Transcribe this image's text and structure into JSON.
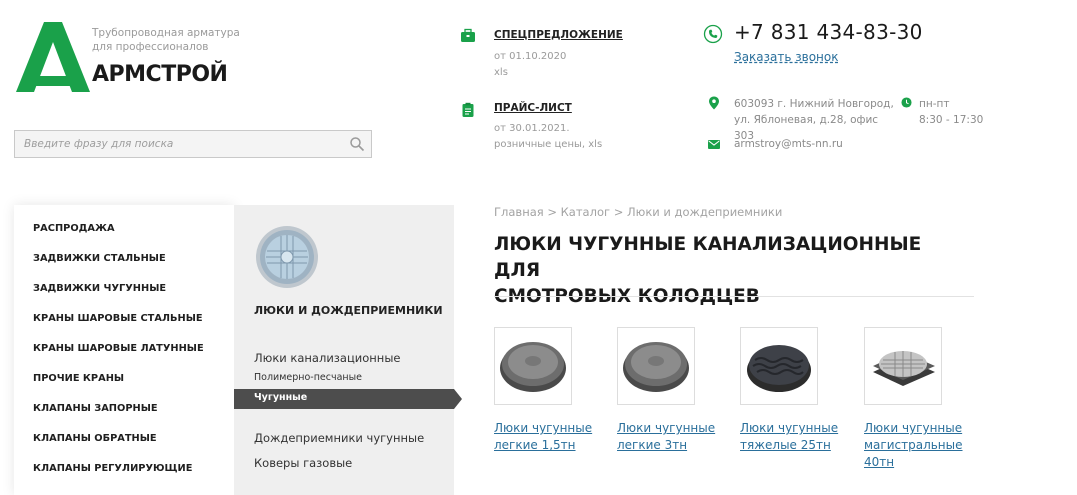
{
  "brand": {
    "name": "АРМСТРОЙ",
    "tagline_line1": "Трубопроводная арматура",
    "tagline_line2": "для профессионалов",
    "color": "#1aa14a"
  },
  "search": {
    "placeholder": "Введите фразу для поиска"
  },
  "special_offer": {
    "title": "СПЕЦПРЕДЛОЖЕНИЕ",
    "date": "от 01.10.2020",
    "format": "xls",
    "icon": "briefcase-icon"
  },
  "price_list": {
    "title": "ПРАЙС-ЛИСТ",
    "date": "от 30.01.2021.",
    "format": "розничные цены, xls",
    "icon": "clipboard-icon"
  },
  "contacts": {
    "phone": "+7 831 434-83-30",
    "callback": "Заказать звонок",
    "address_line1": "603093 г. Нижний Новгород,",
    "address_line2": "ул. Яблоневая, д.28, офис 303",
    "hours_line1": "пн-пт",
    "hours_line2": "8:30 - 17:30",
    "email": "armstroy@mts-nn.ru"
  },
  "menu": {
    "items": [
      "РАСПРОДАЖА",
      "ЗАДВИЖКИ СТАЛЬНЫЕ",
      "ЗАДВИЖКИ ЧУГУННЫЕ",
      "КРАНЫ ШАРОВЫЕ СТАЛЬНЫЕ",
      "КРАНЫ ШАРОВЫЕ ЛАТУННЫЕ",
      "ПРОЧИЕ КРАНЫ",
      "КЛАПАНЫ ЗАПОРНЫЕ",
      "КЛАПАНЫ ОБРАТНЫЕ",
      "КЛАПАНЫ РЕГУЛИРУЮЩИЕ"
    ]
  },
  "submenu": {
    "title": "ЛЮКИ И ДОЖДЕПРИЕМНИКИ",
    "link1": "Люки канализационные",
    "link2": "Полимерно-песчаные",
    "active": "Чугунные",
    "link3": "Дождеприемники чугунные",
    "link4": "Коверы газовые"
  },
  "breadcrumbs": {
    "home": "Главная",
    "sep": ">",
    "catalog": "Каталог",
    "current": "Люки и дождеприемники"
  },
  "page": {
    "title_line1": "ЛЮКИ ЧУГУННЫЕ КАНАЛИЗАЦИОННЫЕ ДЛЯ",
    "title_line2": "СМОТРОВЫХ КОЛОДЦЕВ"
  },
  "products": [
    {
      "line1": "Люки чугунные",
      "line2": "легкие 1,5тн",
      "line3": ""
    },
    {
      "line1": "Люки чугунные",
      "line2": "легкие 3тн",
      "line3": ""
    },
    {
      "line1": "Люки чугунные",
      "line2": "тяжелые 25тн",
      "line3": ""
    },
    {
      "line1": "Люки чугунные",
      "line2": "магистральные",
      "line3": "40тн"
    }
  ],
  "colors": {
    "accent_green": "#1aa14a",
    "link_blue": "#2a6f9b",
    "active_menu": "#4d4d4d"
  }
}
